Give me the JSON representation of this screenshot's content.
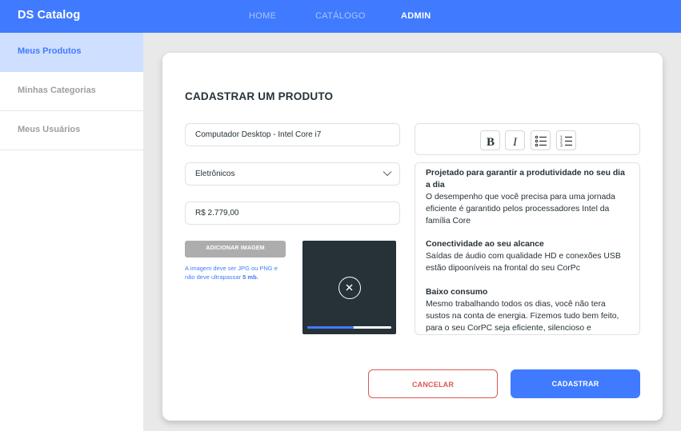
{
  "navbar": {
    "brand": "DS Catalog",
    "links": [
      {
        "label": "HOME",
        "active": false
      },
      {
        "label": "CATÁLOGO",
        "active": false
      },
      {
        "label": "ADMIN",
        "active": true
      }
    ]
  },
  "sidebar": {
    "items": [
      {
        "label": "Meus Produtos",
        "active": true
      },
      {
        "label": "Minhas Categorias",
        "active": false
      },
      {
        "label": "Meus Usuários",
        "active": false
      }
    ]
  },
  "form": {
    "title": "CADASTRAR UM PRODUTO",
    "name_value": "Computador Desktop - Intel Core i7",
    "category_value": "Eletrônicos",
    "price_value": "R$ 2.779,00",
    "add_image_label": "ADICIONAR IMAGEM",
    "image_hint": "A imagem deve ser  JPG ou PNG e não deve ultrapassar",
    "image_hint_limit": "5 mb.",
    "upload_progress": 0.55,
    "toolbar_icons": [
      "bold-icon",
      "italic-icon",
      "bulleted-list-icon",
      "numbered-list-icon"
    ],
    "description": [
      {
        "heading": "Projetado para garantir a produtividade no seu dia a dia",
        "body": "O desempenho que você precisa para uma jornada eficiente é garantido pelos processadores Intel da família Core"
      },
      {
        "heading": "Conectividade ao seu alcance",
        "body": "Saídas de áudio com qualidade HD e conexões USB estão dipooníveis na frontal do seu CorPc"
      },
      {
        "heading": "Baixo consumo",
        "body": "Mesmo trabalhando todos os dias, você não tera sustos na conta de energia. Fizemos tudo bem feito, para o seu CorPC seja eficiente, silencioso e"
      }
    ],
    "cancel_label": "CANCELAR",
    "submit_label": "CADASTRAR"
  },
  "colors": {
    "primary": "#407bff",
    "danger": "#df5753",
    "dark": "#263238",
    "sidebar_active_bg": "#cfdfff"
  }
}
